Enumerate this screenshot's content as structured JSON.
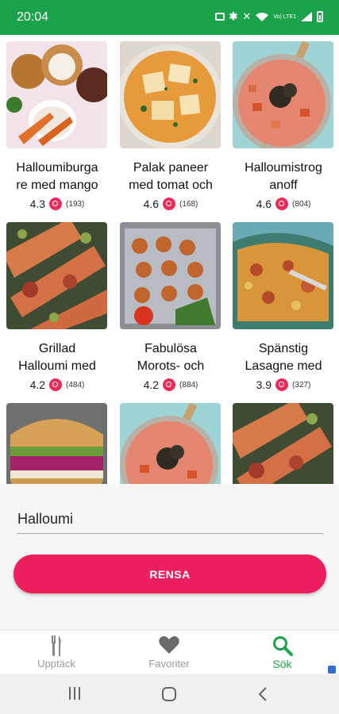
{
  "status": {
    "time": "20:04",
    "network": "Vo) LTE1"
  },
  "recipes": [
    {
      "title_line1": "Halloumiburga",
      "title_line2": "re med mango",
      "rating": "4.3",
      "count": "(193)",
      "image": "burger-bowl"
    },
    {
      "title_line1": "Palak paneer",
      "title_line2": "med tomat och",
      "rating": "4.6",
      "count": "(168)",
      "image": "curry-paneer"
    },
    {
      "title_line1": "Halloumistrog",
      "title_line2": "anoff",
      "rating": "4.6",
      "count": "(804)",
      "image": "stroganoff"
    },
    {
      "title_line1": "Grillad",
      "title_line2": "Halloumi med",
      "rating": "4.2",
      "count": "(484)",
      "image": "grilled-halloumi"
    },
    {
      "title_line1": "Fabulösa",
      "title_line2": "Morots- och",
      "rating": "4.2",
      "count": "(884)",
      "image": "carrot-balls"
    },
    {
      "title_line1": "Spänstig",
      "title_line2": "Lasagne med",
      "rating": "3.9",
      "count": "(327)",
      "image": "lasagne"
    },
    {
      "title_line1": "",
      "title_line2": "",
      "rating": "",
      "count": "",
      "image": "sandwich"
    },
    {
      "title_line1": "",
      "title_line2": "",
      "rating": "",
      "count": "",
      "image": "stroganoff"
    },
    {
      "title_line1": "",
      "title_line2": "",
      "rating": "",
      "count": "",
      "image": "grilled-halloumi"
    }
  ],
  "search": {
    "value": "Halloumi",
    "clear_label": "RENSA"
  },
  "nav": {
    "discover": "Upptäck",
    "favorites": "Favoriter",
    "search": "Sök",
    "active": "search"
  },
  "colors": {
    "status_bar": "#1aa34a",
    "accent": "#ec1e5d",
    "active_tab": "#1aa34a"
  },
  "icons": {
    "discover": "cutlery-icon",
    "favorites": "heart-icon",
    "search": "search-icon"
  }
}
